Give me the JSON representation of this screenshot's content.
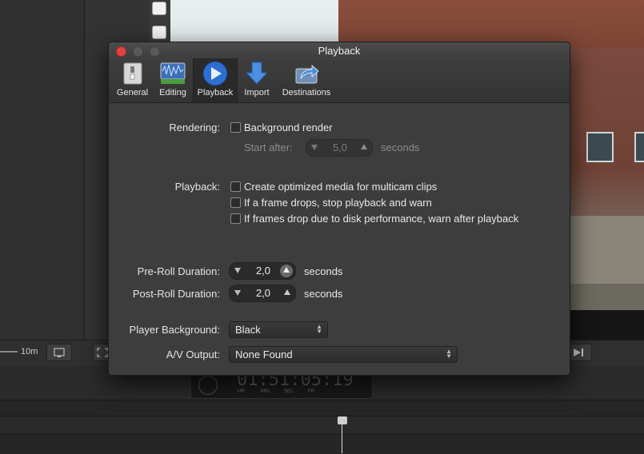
{
  "background": {
    "zoom_label": "10m",
    "timecode": "01:51:05:19",
    "timecode_units": [
      "HR",
      "MIN",
      "SEC",
      "FR"
    ]
  },
  "dialog": {
    "title": "Playback",
    "toolbar": [
      {
        "label": "General",
        "icon": "switch-icon"
      },
      {
        "label": "Editing",
        "icon": "waveform-icon"
      },
      {
        "label": "Playback",
        "icon": "play-icon",
        "selected": true
      },
      {
        "label": "Import",
        "icon": "download-arrow-icon"
      },
      {
        "label": "Destinations",
        "icon": "share-icon"
      }
    ],
    "rendering": {
      "label": "Rendering:",
      "background_render": {
        "label": "Background render",
        "checked": false
      },
      "start_after_label": "Start after:",
      "start_after_value": "5,0",
      "start_after_unit": "seconds"
    },
    "playback": {
      "label": "Playback:",
      "options": [
        {
          "label": "Create optimized media for multicam clips",
          "checked": false
        },
        {
          "label": "If a frame drops, stop playback and warn",
          "checked": false
        },
        {
          "label": "If frames drop due to disk performance, warn after playback",
          "checked": false
        }
      ]
    },
    "pre_roll": {
      "label": "Pre-Roll Duration:",
      "value": "2,0",
      "unit": "seconds"
    },
    "post_roll": {
      "label": "Post-Roll Duration:",
      "value": "2,0",
      "unit": "seconds"
    },
    "player_background": {
      "label": "Player Background:",
      "value": "Black"
    },
    "av_output": {
      "label": "A/V Output:",
      "value": "None Found"
    },
    "colors": {
      "close": "#e0443e",
      "inactive_light": "#5a5a5a",
      "accent_blue": "#3b82d6"
    }
  }
}
